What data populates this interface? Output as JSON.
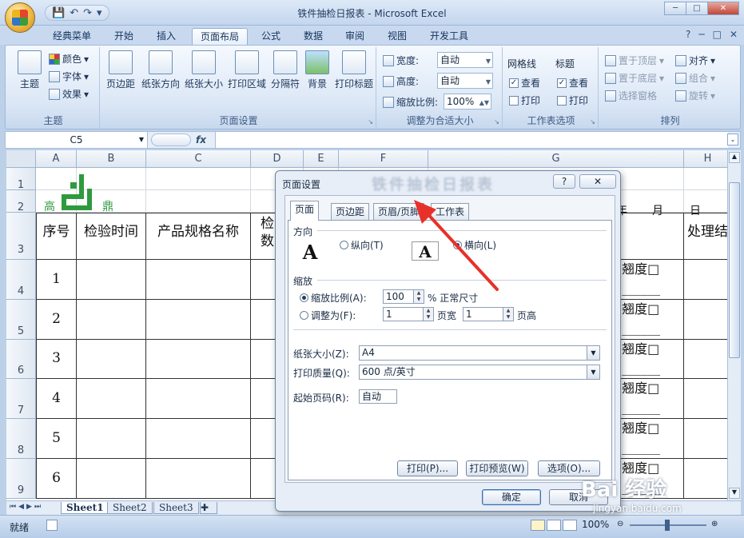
{
  "app": {
    "title": "铁件抽检日报表 - Microsoft Excel"
  },
  "window_controls": {
    "minimize": "─",
    "maximize": "□",
    "close": "✕"
  },
  "qat": {
    "save": "💾",
    "undo": "↶",
    "redo": "↷",
    "more": "▾"
  },
  "ribbon_tabs": [
    {
      "label": "经典菜单"
    },
    {
      "label": "开始"
    },
    {
      "label": "插入"
    },
    {
      "label": "页面布局"
    },
    {
      "label": "公式"
    },
    {
      "label": "数据"
    },
    {
      "label": "审阅"
    },
    {
      "label": "视图"
    },
    {
      "label": "开发工具"
    }
  ],
  "ribbon_help": {
    "help": "?",
    "min": "─",
    "restore": "□",
    "close": "✕"
  },
  "groups": {
    "theme": {
      "label": "主题",
      "theme_btn": "主题",
      "colors": "颜色",
      "fonts": "字体",
      "effects": "效果"
    },
    "page_setup": {
      "label": "页面设置",
      "margins": "页边距",
      "orientation": "纸张方向",
      "size": "纸张大小",
      "print_area": "打印区域",
      "breaks": "分隔符",
      "background": "背景",
      "print_titles": "打印标题"
    },
    "scale_to_fit": {
      "label": "调整为合适大小",
      "width_label": "宽度:",
      "width_value": "自动",
      "height_label": "高度:",
      "height_value": "自动",
      "scale_label": "缩放比例:",
      "scale_value": "100%"
    },
    "sheet_options": {
      "label": "工作表选项",
      "gridlines": "网格线",
      "headings": "标题",
      "view": "查看",
      "print": "打印"
    },
    "arrange": {
      "label": "排列",
      "bring_front": "置于顶层",
      "send_back": "置于底层",
      "selection_pane": "选择窗格",
      "align": "对齐",
      "group": "组合",
      "rotate": "旋转"
    }
  },
  "formula_bar": {
    "name_box": "C5",
    "fx": "fx",
    "formula": ""
  },
  "sheet": {
    "columns": [
      "A",
      "B",
      "C",
      "D",
      "E",
      "F",
      "G",
      "H"
    ],
    "rows": [
      "1",
      "2",
      "3",
      "4",
      "5",
      "6",
      "7",
      "8",
      "9"
    ],
    "logo_left": "高",
    "logo_right": "鼎",
    "headers": [
      "序号",
      "检验时间",
      "产品规格名称",
      "检",
      "数"
    ],
    "row2_right": [
      "年",
      "月",
      "日"
    ],
    "right_header": "处理结",
    "numbers": [
      "1",
      "2",
      "3",
      "4",
      "5",
      "6"
    ],
    "g_text": "□翘度□",
    "g_line": "□______"
  },
  "sheet_tabs": [
    "Sheet1",
    "Sheet2",
    "Sheet3"
  ],
  "status": {
    "ready": "就绪",
    "zoom": "100%"
  },
  "dialog": {
    "title": "页面设置",
    "blurred_title": "铁件抽检日报表",
    "help": "?",
    "close": "✕",
    "tabs": [
      "页面",
      "页边距",
      "页眉/页脚",
      "工作表"
    ],
    "orientation_label": "方向",
    "portrait": "纵向(T)",
    "landscape": "横向(L)",
    "orientation_icon": "A",
    "scaling_label": "缩放",
    "adjust_to": "缩放比例(A):",
    "adjust_value": "100",
    "adjust_suffix": "% 正常尺寸",
    "fit_to": "调整为(F):",
    "fit_wide_value": "1",
    "fit_wide_label": "页宽",
    "fit_tall_value": "1",
    "fit_tall_label": "页高",
    "paper_size_label": "纸张大小(Z):",
    "paper_size_value": "A4",
    "print_quality_label": "打印质量(Q):",
    "print_quality_value": "600 点/英寸",
    "first_page_label": "起始页码(R):",
    "first_page_value": "自动",
    "print_btn": "打印(P)...",
    "preview_btn": "打印预览(W)",
    "options_btn": "选项(O)...",
    "ok_btn": "确定",
    "cancel_btn": "取消"
  },
  "watermark": {
    "brand": "Bai 经验",
    "url": "jingyan.baidu.com"
  },
  "colors": {
    "annotation_arrow": "#e8302a",
    "logo_green": "#2e9a3e"
  }
}
